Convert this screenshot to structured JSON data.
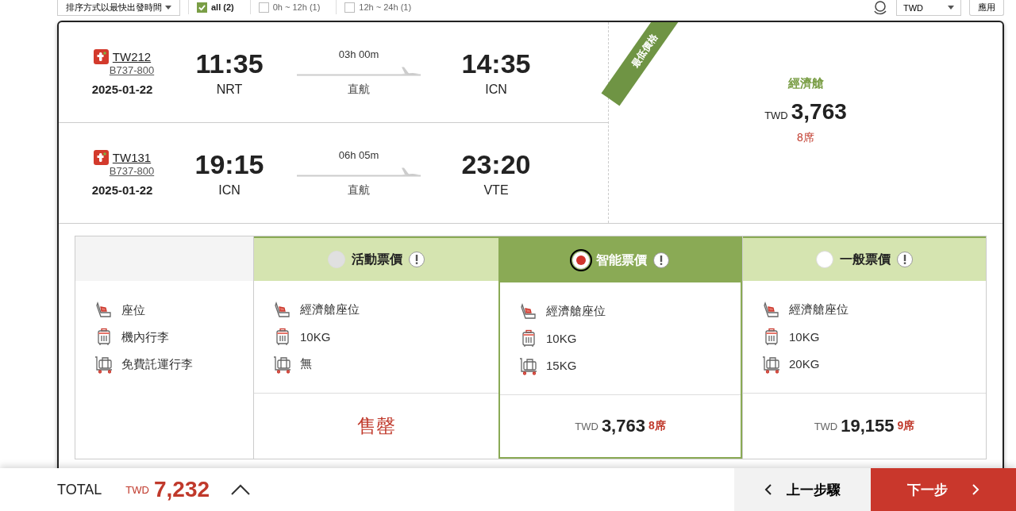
{
  "filter_bar": {
    "sort_select": "排序方式以最快出發時間",
    "filters": [
      {
        "label": "all (2)",
        "checked": true
      },
      {
        "label": "0h ~ 12h (1)",
        "checked": false
      },
      {
        "label": "12h ~ 24h (1)",
        "checked": false
      }
    ],
    "currency": "TWD",
    "apply_button": "應用"
  },
  "flights": [
    {
      "flight_no": "TW212",
      "aircraft": "B737-800",
      "date": "2025-01-22",
      "depart_time": "11:35",
      "depart_airport": "NRT",
      "duration": "03h 00m",
      "stops": "直航",
      "arrive_time": "14:35",
      "arrive_airport": "ICN"
    },
    {
      "flight_no": "TW131",
      "aircraft": "B737-800",
      "date": "2025-01-22",
      "depart_time": "19:15",
      "depart_airport": "ICN",
      "duration": "06h 05m",
      "stops": "直航",
      "arrive_time": "23:20",
      "arrive_airport": "VTE"
    }
  ],
  "price_panel": {
    "ribbon": "最低價格",
    "cabin": "經濟艙",
    "currency": "TWD",
    "price": "3,763",
    "seats": "8席"
  },
  "fare_table": {
    "features": [
      {
        "kind": "seat",
        "label": "座位"
      },
      {
        "kind": "cabin-bag",
        "label": "機內行李"
      },
      {
        "kind": "checked-bag",
        "label": "免費託運行李"
      }
    ],
    "fares": [
      {
        "name": "活動票價",
        "selected": false,
        "disabled": true,
        "values": [
          "經濟艙座位",
          "10KG",
          "無"
        ],
        "kind": "sold-out",
        "status": "售罄"
      },
      {
        "name": "智能票價",
        "selected": true,
        "disabled": false,
        "values": [
          "經濟艙座位",
          "10KG",
          "15KG"
        ],
        "kind": "price",
        "currency": "TWD",
        "price": "3,763",
        "seats": "8席"
      },
      {
        "name": "一般票價",
        "selected": false,
        "disabled": false,
        "values": [
          "經濟艙座位",
          "10KG",
          "20KG"
        ],
        "kind": "price",
        "currency": "TWD",
        "price": "19,155",
        "seats": "9席"
      }
    ]
  },
  "footer": {
    "total_label": "TOTAL",
    "currency": "TWD",
    "total": "7,232",
    "back_button": "上一步驟",
    "next_button": "下一步"
  }
}
